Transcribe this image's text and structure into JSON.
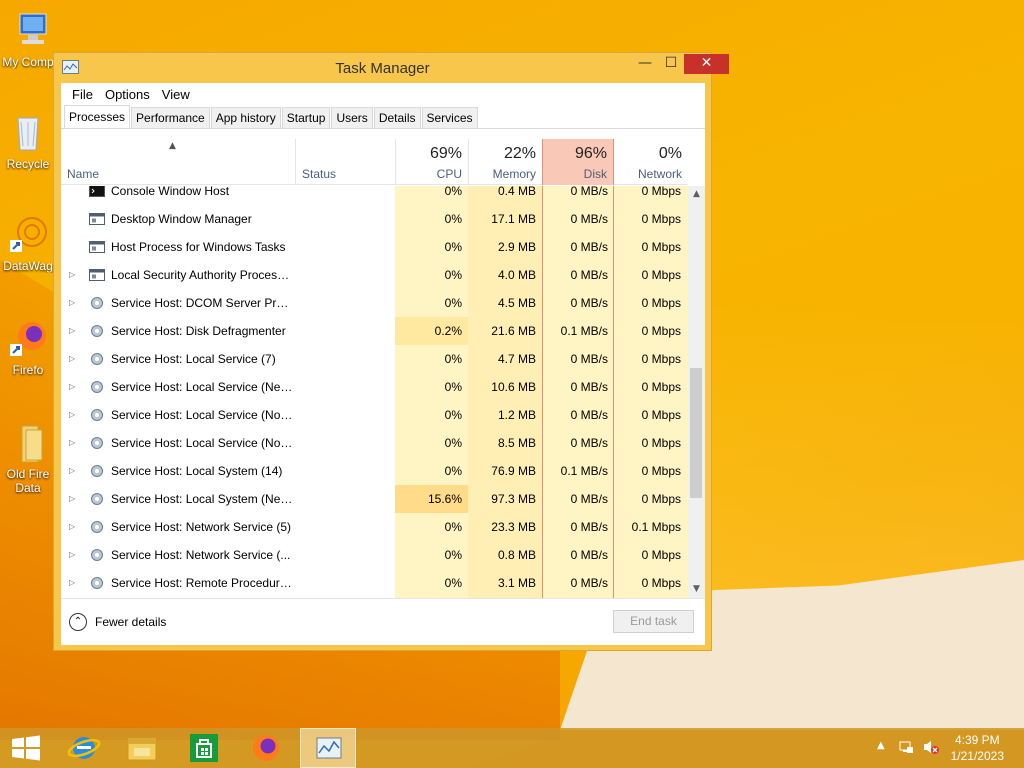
{
  "desktop": {
    "icons": [
      {
        "label": "My Comp"
      },
      {
        "label": "Recycle"
      },
      {
        "label": "DataWag"
      },
      {
        "label": "Firefo"
      },
      {
        "label": "Old Fire"
      },
      {
        "label": "Data"
      }
    ]
  },
  "window": {
    "title": "Task Manager",
    "minimize": "—",
    "maximize": "☐",
    "close": "✕"
  },
  "menu": [
    "File",
    "Options",
    "View"
  ],
  "tabs": [
    "Processes",
    "Performance",
    "App history",
    "Startup",
    "Users",
    "Details",
    "Services"
  ],
  "columns": {
    "name": "Name",
    "status": "Status",
    "cpu": {
      "percent": "69%",
      "label": "CPU"
    },
    "memory": {
      "percent": "22%",
      "label": "Memory"
    },
    "disk": {
      "percent": "96%",
      "label": "Disk"
    },
    "network": {
      "percent": "0%",
      "label": "Network"
    }
  },
  "processes": [
    {
      "name": "Console Window Host",
      "cpu": "0%",
      "memory": "0.4 MB",
      "disk": "0 MB/s",
      "network": "0 Mbps",
      "icon": "console-icon",
      "expandable": false
    },
    {
      "name": "Desktop Window Manager",
      "cpu": "0%",
      "memory": "17.1 MB",
      "disk": "0 MB/s",
      "network": "0 Mbps",
      "icon": "window-app-icon",
      "expandable": false
    },
    {
      "name": "Host Process for Windows Tasks",
      "cpu": "0%",
      "memory": "2.9 MB",
      "disk": "0 MB/s",
      "network": "0 Mbps",
      "icon": "window-app-icon",
      "expandable": false
    },
    {
      "name": "Local Security Authority Process...",
      "cpu": "0%",
      "memory": "4.0 MB",
      "disk": "0 MB/s",
      "network": "0 Mbps",
      "icon": "window-app-icon",
      "expandable": true
    },
    {
      "name": "Service Host: DCOM Server Proc...",
      "cpu": "0%",
      "memory": "4.5 MB",
      "disk": "0 MB/s",
      "network": "0 Mbps",
      "icon": "service-gear-icon",
      "expandable": true
    },
    {
      "name": "Service Host: Disk Defragmenter",
      "cpu": "0.2%",
      "memory": "21.6 MB",
      "disk": "0.1 MB/s",
      "network": "0 Mbps",
      "icon": "service-gear-icon",
      "expandable": true
    },
    {
      "name": "Service Host: Local Service (7)",
      "cpu": "0%",
      "memory": "4.7 MB",
      "disk": "0 MB/s",
      "network": "0 Mbps",
      "icon": "service-gear-icon",
      "expandable": true
    },
    {
      "name": "Service Host: Local Service (Net...",
      "cpu": "0%",
      "memory": "10.6 MB",
      "disk": "0 MB/s",
      "network": "0 Mbps",
      "icon": "service-gear-icon",
      "expandable": true
    },
    {
      "name": "Service Host: Local Service (No I...",
      "cpu": "0%",
      "memory": "1.2 MB",
      "disk": "0 MB/s",
      "network": "0 Mbps",
      "icon": "service-gear-icon",
      "expandable": true
    },
    {
      "name": "Service Host: Local Service (No ...",
      "cpu": "0%",
      "memory": "8.5 MB",
      "disk": "0 MB/s",
      "network": "0 Mbps",
      "icon": "service-gear-icon",
      "expandable": true
    },
    {
      "name": "Service Host: Local System (14)",
      "cpu": "0%",
      "memory": "76.9 MB",
      "disk": "0.1 MB/s",
      "network": "0 Mbps",
      "icon": "service-gear-icon",
      "expandable": true
    },
    {
      "name": "Service Host: Local System (Net...",
      "cpu": "15.6%",
      "memory": "97.3 MB",
      "disk": "0 MB/s",
      "network": "0 Mbps",
      "icon": "service-gear-icon",
      "expandable": true
    },
    {
      "name": "Service Host: Network Service (5)",
      "cpu": "0%",
      "memory": "23.3 MB",
      "disk": "0 MB/s",
      "network": "0.1 Mbps",
      "icon": "service-gear-icon",
      "expandable": true
    },
    {
      "name": "Service Host: Network Service (...",
      "cpu": "0%",
      "memory": "0.8 MB",
      "disk": "0 MB/s",
      "network": "0 Mbps",
      "icon": "service-gear-icon",
      "expandable": true
    },
    {
      "name": "Service Host: Remote Procedure...",
      "cpu": "0%",
      "memory": "3.1 MB",
      "disk": "0 MB/s",
      "network": "0 Mbps",
      "icon": "service-gear-icon",
      "expandable": true
    }
  ],
  "footer": {
    "fewer_details": "Fewer details",
    "end_task": "End task"
  },
  "taskbar": {
    "time": "4:39 PM",
    "date": "1/21/2023",
    "apps": [
      "start-icon",
      "internet-explorer-icon",
      "file-explorer-icon",
      "store-icon",
      "firefox-icon",
      "task-manager-icon"
    ]
  },
  "colors": {
    "desktop": "#f7b400",
    "window_frame": "#f7c64a",
    "disk_header": "#f9c8b6",
    "heat_light": "#fff4c4",
    "close_button": "#c7302b"
  }
}
